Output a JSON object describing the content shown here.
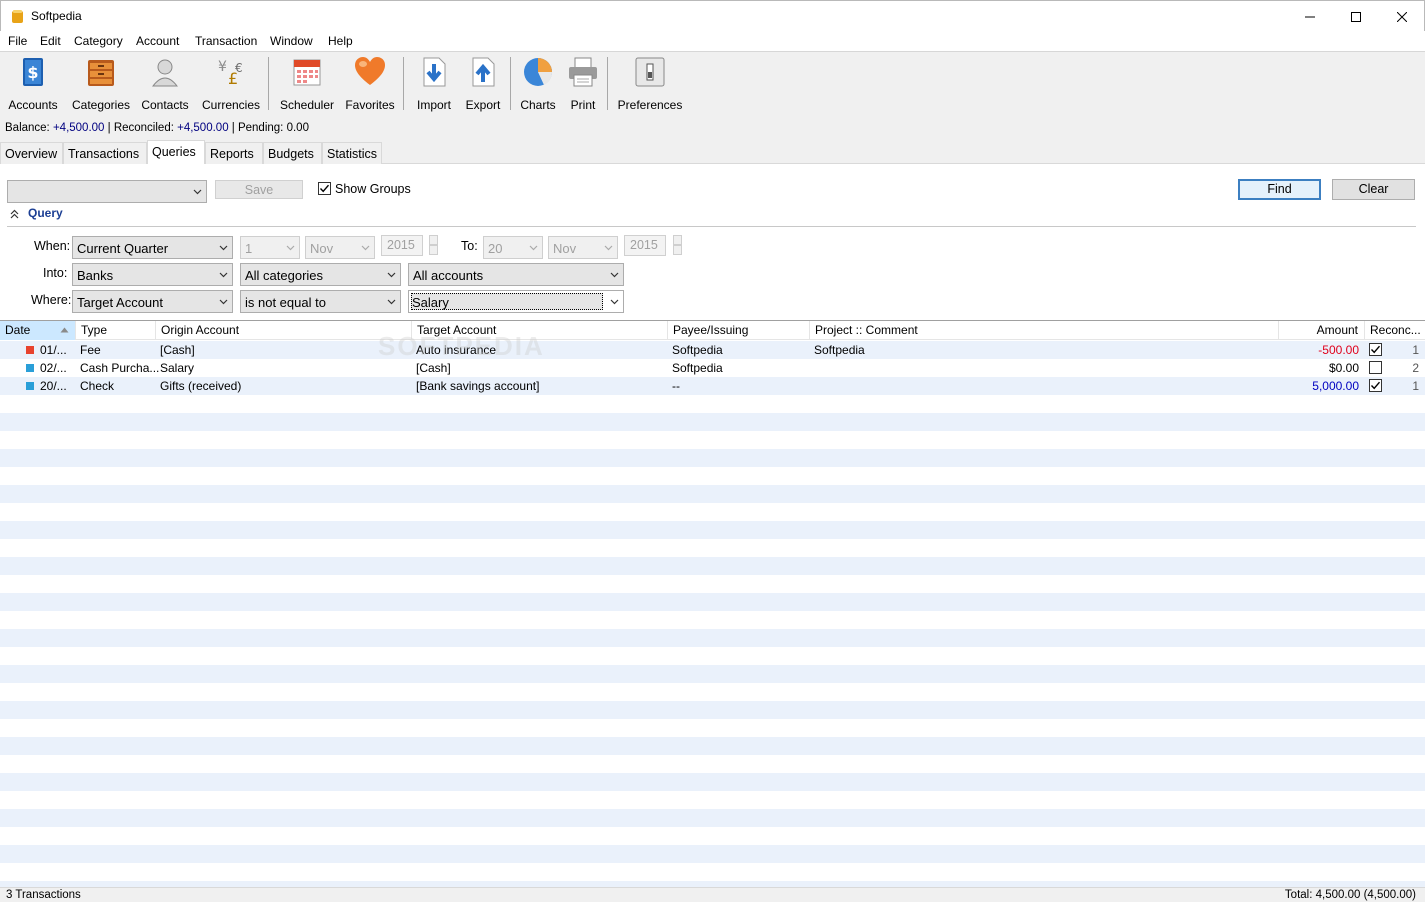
{
  "window": {
    "title": "Softpedia"
  },
  "menu": [
    "File",
    "Edit",
    "Category",
    "Account",
    "Transaction",
    "Window",
    "Help"
  ],
  "toolbar": [
    {
      "label": "Accounts",
      "icon": "accounts-icon"
    },
    {
      "label": "Categories",
      "icon": "categories-icon"
    },
    {
      "label": "Contacts",
      "icon": "contacts-icon"
    },
    {
      "label": "Currencies",
      "icon": "currencies-icon"
    },
    {
      "label": "Scheduler",
      "icon": "scheduler-icon"
    },
    {
      "label": "Favorites",
      "icon": "favorites-icon"
    },
    {
      "label": "Import",
      "icon": "import-icon"
    },
    {
      "label": "Export",
      "icon": "export-icon"
    },
    {
      "label": "Charts",
      "icon": "charts-icon"
    },
    {
      "label": "Print",
      "icon": "print-icon"
    },
    {
      "label": "Preferences",
      "icon": "preferences-icon"
    }
  ],
  "balance": {
    "balance_label": "Balance: ",
    "balance_value": "+4,500.00",
    "reconciled_label": " | Reconciled: ",
    "reconciled_value": "+4,500.00",
    "pending_label": " | Pending: ",
    "pending_value": "0.00"
  },
  "tabs": [
    "Overview",
    "Transactions",
    "Queries",
    "Reports",
    "Budgets",
    "Statistics"
  ],
  "active_tab": "Queries",
  "query": {
    "saved_query_value": "",
    "save_label": "Save",
    "show_groups_label": "Show Groups",
    "show_groups_checked": true,
    "find_label": "Find",
    "clear_label": "Clear",
    "section_label": "Query",
    "when_label": "When:",
    "when_value": "Current Quarter",
    "from_day": "1",
    "from_month": "Nov",
    "from_year": "2015",
    "to_label": "To:",
    "to_day": "20",
    "to_month": "Nov",
    "to_year": "2015",
    "into_label": "Into:",
    "into_value": "Banks",
    "category_value": "All categories",
    "accounts_value": "All accounts",
    "where_label": "Where:",
    "where_field": "Target Account",
    "where_op": "is not equal to",
    "where_value": "Salary"
  },
  "table": {
    "columns": [
      "Date",
      "Type",
      "Origin Account",
      "Target Account",
      "Payee/Issuing",
      "Project :: Comment",
      "Amount",
      "Reconc..."
    ],
    "rows": [
      {
        "date": "01/...",
        "color": "#e8432e",
        "type": "Fee",
        "origin": "[Cash]",
        "target": "Auto insurance",
        "payee": "Softpedia",
        "project": "Softpedia",
        "amount": "-500.00",
        "amount_color": "#e0001b",
        "reconciled": true,
        "count": "1"
      },
      {
        "date": "02/...",
        "color": "#2a9fd8",
        "type": "Cash Purcha...",
        "origin": "Salary",
        "target": "[Cash]",
        "payee": "Softpedia",
        "project": "",
        "amount": "$0.00",
        "amount_color": "#000000",
        "reconciled": false,
        "count": "2"
      },
      {
        "date": "20/...",
        "color": "#2a9fd8",
        "type": "Check",
        "origin": "Gifts (received)",
        "target": "[Bank savings account]",
        "payee": "--",
        "project": "",
        "amount": "5,000.00",
        "amount_color": "#0000c0",
        "reconciled": true,
        "count": "1"
      }
    ]
  },
  "watermark": "SOFTPEDIA",
  "status": {
    "left": "3 Transactions",
    "right": "Total: 4,500.00 (4,500.00)"
  }
}
